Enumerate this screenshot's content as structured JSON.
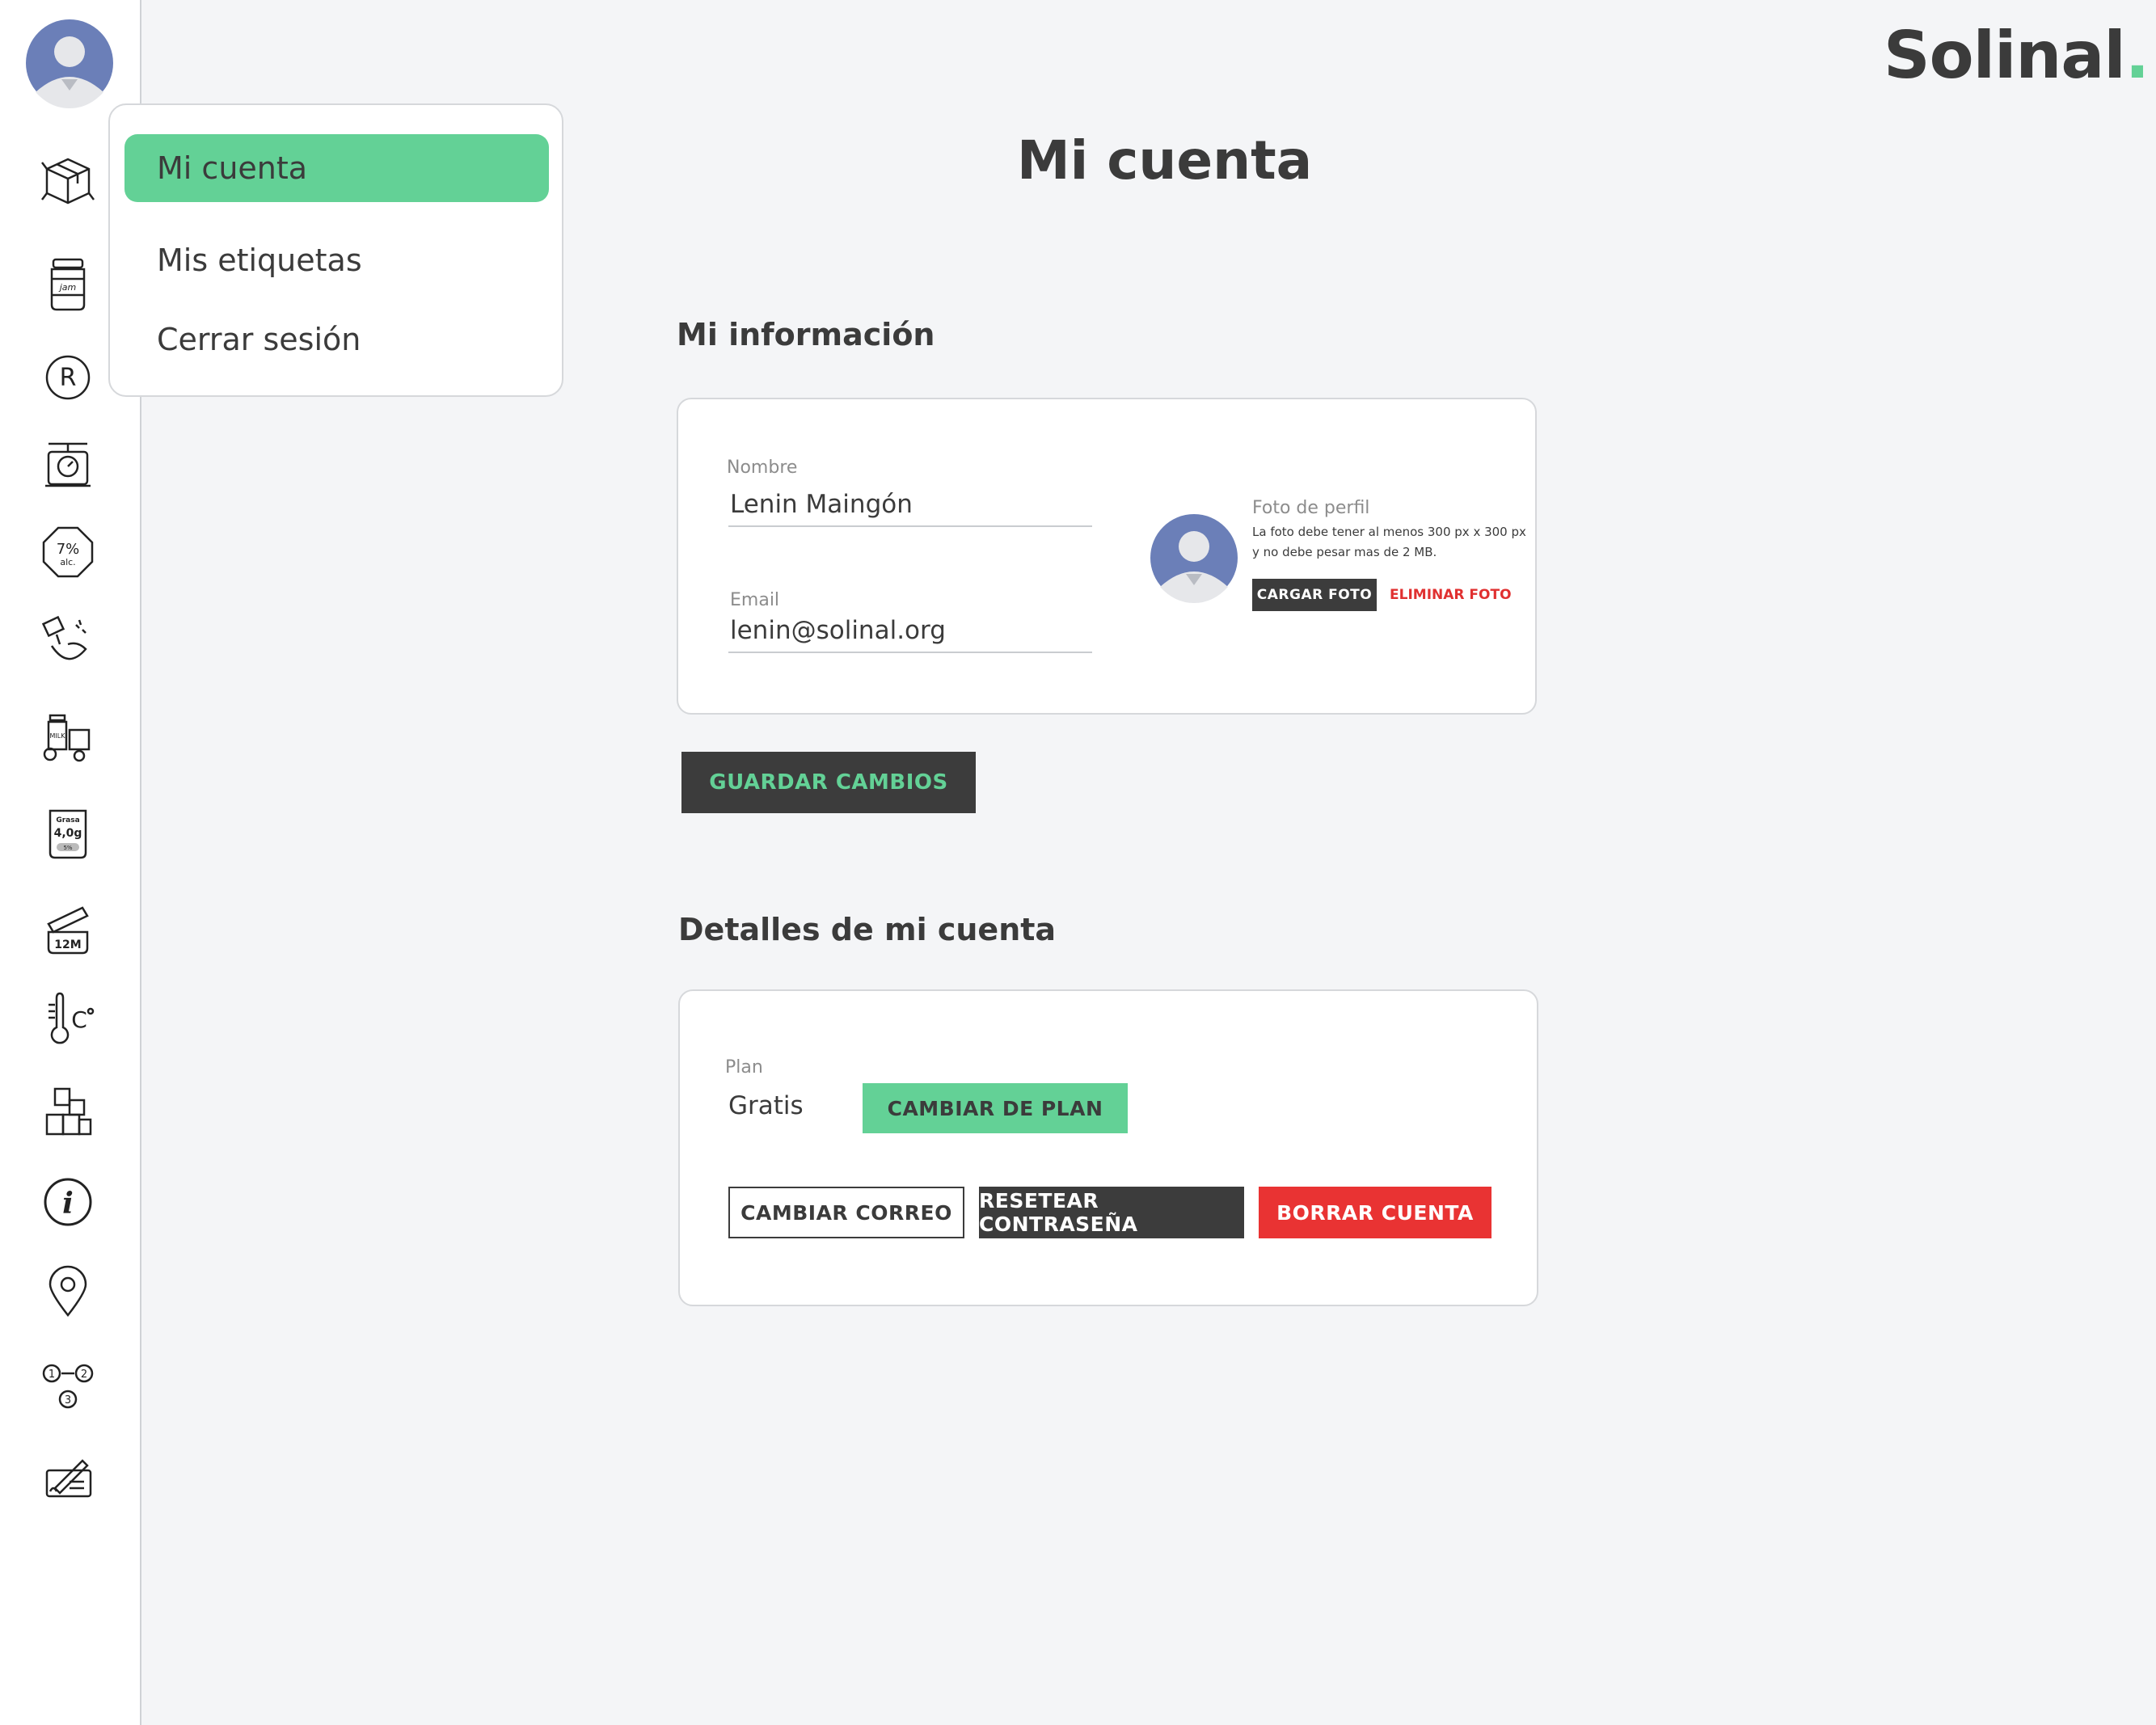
{
  "brand": {
    "name": "Solinal",
    "dot": ".",
    "dot_color": "#63d196"
  },
  "menu": {
    "items": [
      {
        "label": "Mi cuenta",
        "active": true
      },
      {
        "label": "Mis etiquetas",
        "active": false
      },
      {
        "label": "Cerrar sesión",
        "active": false
      }
    ]
  },
  "sidebar": {
    "icons": [
      "box-icon",
      "jam-jar-icon",
      "registered-icon",
      "kitchen-scale-icon",
      "alcohol-percent-icon",
      "pouring-icon",
      "ingredients-icon",
      "nutrition-label-icon",
      "open-jar-12m-icon",
      "temperature-icon",
      "boxes-icon",
      "info-icon",
      "location-pin-icon",
      "steps-icon",
      "signature-icon"
    ]
  },
  "page": {
    "title": "Mi cuenta"
  },
  "info_section": {
    "title": "Mi información",
    "name_label": "Nombre",
    "name_value": "Lenin Maingón",
    "email_label": "Email",
    "email_value": "lenin@solinal.org",
    "photo_label": "Foto de perfil",
    "photo_hint_1": "La foto debe tener al menos 300 px x 300 px",
    "photo_hint_2": "y no debe pesar mas de 2 MB.",
    "upload_label": "CARGAR FOTO",
    "delete_label": "ELIMINAR FOTO",
    "save_label": "GUARDAR CAMBIOS"
  },
  "account_section": {
    "title": "Detalles de mi cuenta",
    "plan_label": "Plan",
    "plan_value": "Gratis",
    "change_plan_label": "CAMBIAR DE PLAN",
    "change_email_label": "CAMBIAR CORREO",
    "reset_password_label": "RESETEAR CONTRASEÑA",
    "delete_account_label": "BORRAR CUENTA"
  },
  "colors": {
    "accent": "#63d196",
    "danger": "#e93333",
    "dark": "#3c3c3c",
    "avatar": "#6b7fb8"
  }
}
